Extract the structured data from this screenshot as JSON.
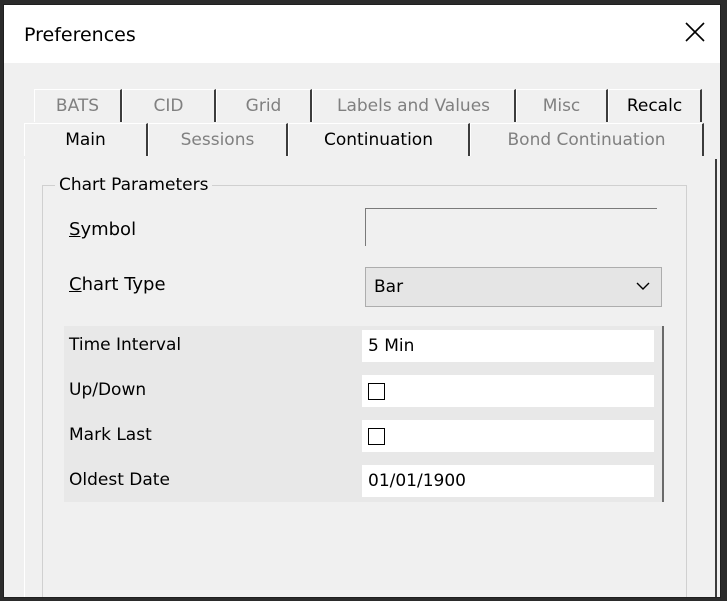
{
  "window": {
    "title": "Preferences",
    "close_icon": "close-icon"
  },
  "tabs_row1": [
    {
      "label": "BATS",
      "active": false
    },
    {
      "label": "CID",
      "active": false
    },
    {
      "label": "Grid",
      "active": false
    },
    {
      "label": "Labels and Values",
      "active": false
    },
    {
      "label": "Misc",
      "active": false
    },
    {
      "label": "Recalc",
      "active": true
    }
  ],
  "tabs_row2": [
    {
      "label": "Main",
      "active": true
    },
    {
      "label": "Sessions",
      "active": false
    },
    {
      "label": "Continuation",
      "active": true
    },
    {
      "label": "Bond Continuation",
      "active": false
    }
  ],
  "group": {
    "title": "Chart Parameters"
  },
  "symbol": {
    "label_accel": "S",
    "label_rest": "ymbol",
    "value": ""
  },
  "chart_type": {
    "label_accel": "C",
    "label_rest": "hart Type",
    "value": "Bar",
    "icon": "chevron-down-icon"
  },
  "params": [
    {
      "label": "Time Interval",
      "value": "5 Min",
      "kind": "text"
    },
    {
      "label": "Up/Down",
      "value": "",
      "kind": "checkbox",
      "checked": false
    },
    {
      "label": "Mark Last",
      "value": "",
      "kind": "checkbox",
      "checked": false
    },
    {
      "label": "Oldest Date",
      "value": "01/01/1900",
      "kind": "text"
    }
  ]
}
